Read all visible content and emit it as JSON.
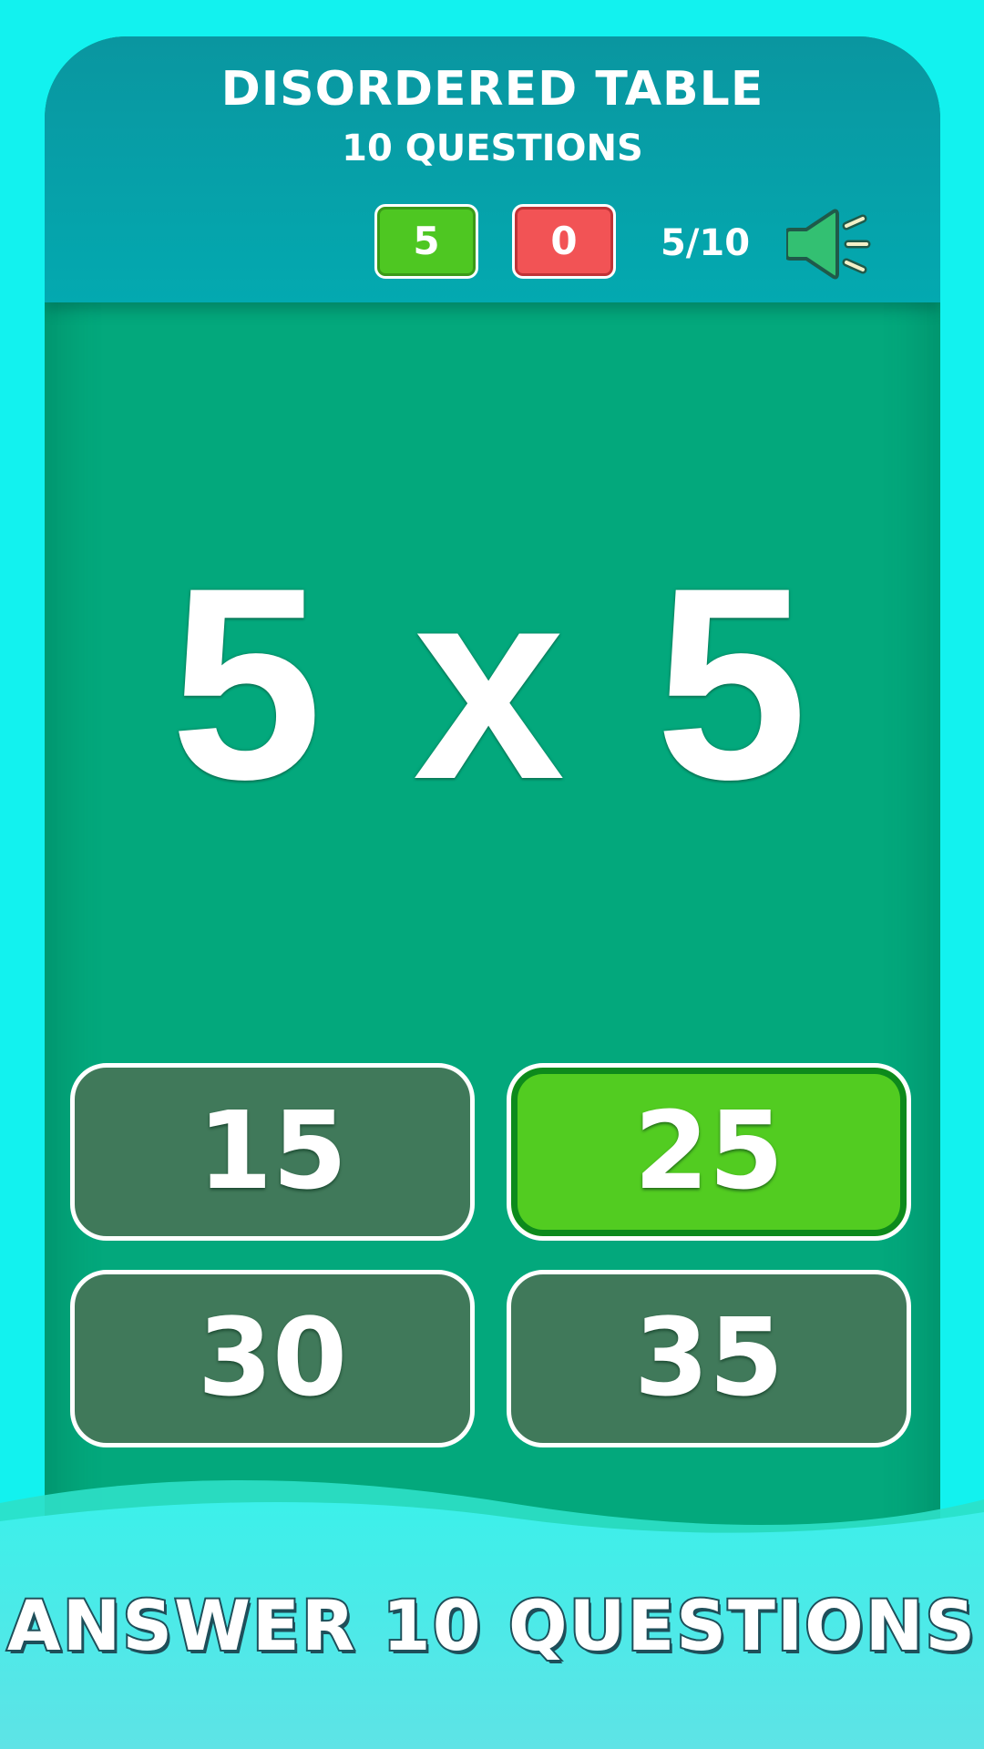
{
  "header": {
    "title": "DISORDERED TABLE",
    "subtitle": "10 QUESTIONS"
  },
  "score": {
    "correct": "5",
    "wrong": "0",
    "progress": "5/10",
    "correct_color": "#4ec722",
    "wrong_color": "#f25355"
  },
  "sound": {
    "icon": "speaker-on-icon"
  },
  "question": {
    "text": "5 x 5"
  },
  "answers": [
    {
      "label": "15",
      "selected": false
    },
    {
      "label": "25",
      "selected": true
    },
    {
      "label": "30",
      "selected": false
    },
    {
      "label": "35",
      "selected": false
    }
  ],
  "banner": {
    "text": "ANSWER 10 QUESTIONS"
  },
  "colors": {
    "background": "#12f2ef",
    "board": "#03a87c",
    "header": "#03a9b0",
    "answer_default": "#40795a",
    "answer_selected": "#52cc21"
  }
}
